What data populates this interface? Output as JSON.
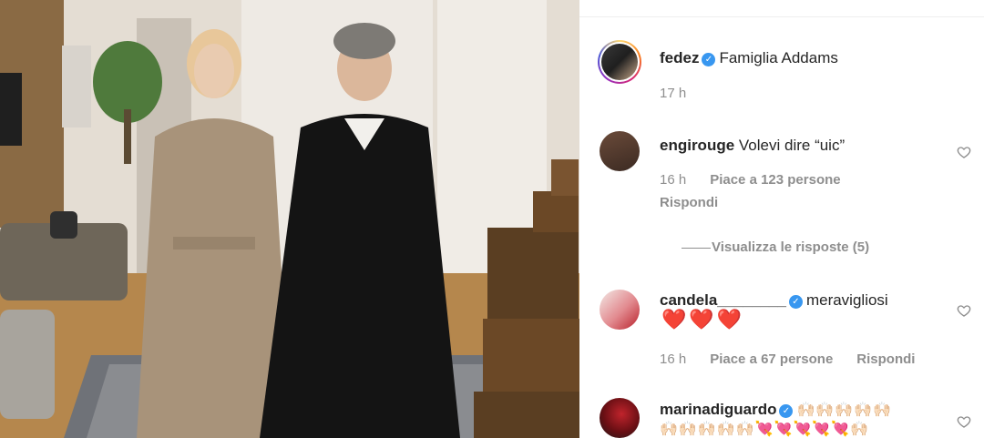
{
  "post": {
    "author": "fedez",
    "caption": "Famiglia Addams",
    "time": "17 h"
  },
  "comments": [
    {
      "user": "engirouge",
      "verified": false,
      "text": "Volevi dire “uic”",
      "time": "16 h",
      "likes": "Piace a 123 persone",
      "reply": "Rispondi",
      "view_replies": "Visualizza le risposte (5)"
    },
    {
      "user": "candela________",
      "verified": true,
      "text": "meravigliosi",
      "emoji": "❤️❤️❤️",
      "time": "16 h",
      "likes": "Piace a 67 persone",
      "reply": "Rispondi"
    },
    {
      "user": "marinadiguardo",
      "verified": true,
      "emoji_line1": "🙌🏻🙌🏻🙌🏻🙌🏻🙌🏻",
      "emoji_line2": "🙌🏻🙌🏻🙌🏻🙌🏻🙌🏻💘💘💘💘💘🙌🏻"
    }
  ],
  "icons": {
    "verified": "verified-badge-icon",
    "like": "heart-outline-icon"
  },
  "colors": {
    "username": "#262626",
    "meta": "#8e8e8e",
    "verified": "#3897f0",
    "heart_red": "#d7192a"
  }
}
